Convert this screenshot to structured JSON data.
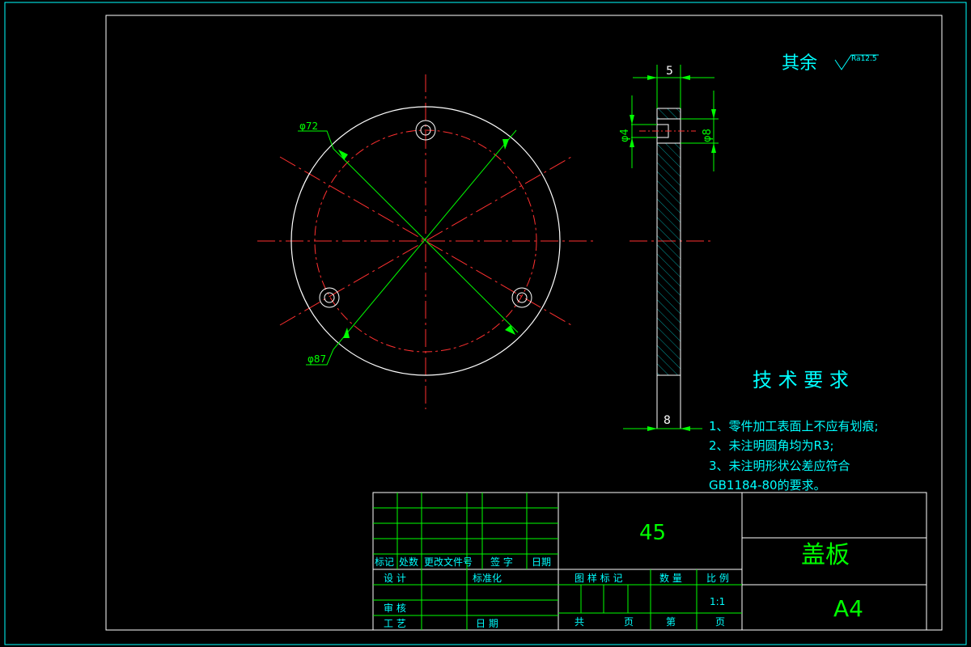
{
  "surface_finish": {
    "label": "其余",
    "ra_value": "Ra12.5"
  },
  "front_view": {
    "dim_outer": "φ87",
    "dim_bolt_circle": "φ72"
  },
  "side_view": {
    "dim_width_top": "5",
    "dim_width_bottom": "8",
    "dim_hole_small": "φ4",
    "dim_hole_large": "φ8"
  },
  "tech_requirements": {
    "title": "技 术 要 求",
    "items": [
      "1、零件加工表面上不应有划痕;",
      "2、未注明圆角均为R3;",
      "3、未注明形状公差应符合",
      "GB1184-80的要求。"
    ]
  },
  "title_block": {
    "material": "45",
    "part_name": "盖板",
    "sheet_size": "A4",
    "revision_headers": [
      "标记",
      "处数",
      "更改文件号",
      "签 字",
      "日期"
    ],
    "labels": {
      "design": "设 计",
      "standardize": "标准化",
      "review": "审 核",
      "process": "工 艺",
      "date": "日 期",
      "drawing_mark": "图 样 标 记",
      "quantity": "数 量",
      "scale": "比 例",
      "scale_value": "1:1",
      "total": "共",
      "sheet": "页",
      "number": "第",
      "sheet2": "页"
    }
  }
}
